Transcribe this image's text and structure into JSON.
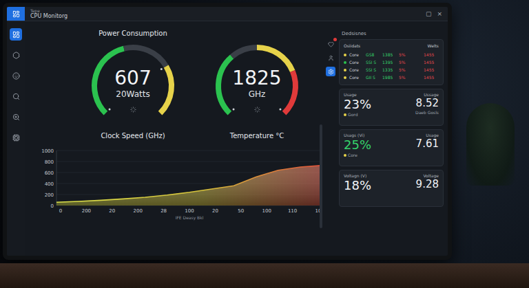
{
  "window": {
    "title": "Tepe",
    "app_title": "CPU Monitorg",
    "controls": [
      "▢",
      "×"
    ]
  },
  "sidebar": {
    "items": [
      {
        "selected": true
      },
      {
        "selected": false
      },
      {
        "selected": false
      },
      {
        "selected": false
      },
      {
        "selected": false
      },
      {
        "selected": false
      }
    ]
  },
  "gauges": [
    {
      "title": "Power Consumption",
      "value": "607",
      "unit": "20Watts",
      "caption": "Clock Speed (GHz)",
      "level": 0.72,
      "segments": [
        {
          "color": "#2bc24f",
          "level": 0.45
        },
        {
          "color": "#3a3f47",
          "level": 0.72
        },
        {
          "color": "#e6d24a",
          "level": 1
        }
      ]
    },
    {
      "title": "",
      "value": "1825",
      "unit": "GHz",
      "caption": "Temperature °C",
      "level": 1,
      "segments": [
        {
          "color": "#2bc24f",
          "level": 0.35
        },
        {
          "color": "#3a3f47",
          "level": 0.5
        },
        {
          "color": "#e6d24a",
          "level": 0.75
        },
        {
          "color": "#e03a3a",
          "level": 1
        }
      ]
    }
  ],
  "chart": {
    "y_ticks": [
      "1000",
      "800",
      "600",
      "400",
      "200",
      "0"
    ],
    "x_ticks": [
      "0",
      "200",
      "20",
      "200",
      "28",
      "100",
      "20",
      "50",
      "100",
      "110",
      "10"
    ],
    "x_label": "IFE Deasy Bkl",
    "y_min": 0,
    "y_max": 1000,
    "series": [
      {
        "values": [
          60,
          75,
          95,
          120,
          150,
          190,
          240,
          300,
          360,
          520,
          640,
          700,
          730
        ]
      }
    ]
  },
  "panel": {
    "title": "Dedsisnes",
    "tabs": [
      {
        "selected": false,
        "badge": true
      },
      {
        "selected": false,
        "badge": false
      },
      {
        "selected": true,
        "badge": false
      }
    ],
    "table": {
      "title": "Osiidats",
      "unit": "Welts",
      "rows": [
        {
          "name": "Core",
          "color": "#e6d24a",
          "values": [
            "GS8",
            "1385"
          ],
          "readings": [
            "5%",
            "1455"
          ]
        },
        {
          "name": "Core",
          "color": "#2bc24f",
          "values": [
            "SSI S",
            "1395"
          ],
          "readings": [
            "5%",
            "1455"
          ]
        },
        {
          "name": "Core",
          "color": "#e6d24a",
          "values": [
            "SSI S",
            "1335"
          ],
          "readings": [
            "5%",
            "1455"
          ]
        },
        {
          "name": "Core",
          "color": "#e6d24a",
          "values": [
            "GII S",
            "1985"
          ],
          "readings": [
            "5%",
            "1455"
          ]
        }
      ]
    },
    "cards": [
      {
        "label": "Usage",
        "value": "23%",
        "value_color": "#f2f4f7",
        "sub": "Gord",
        "right_label": "Ussage",
        "right_value": "8.52",
        "right_sub": "Daeb Gosls"
      },
      {
        "label": "Usags (Vi)",
        "value": "25%",
        "value_color": "#35d16a",
        "sub": "Core",
        "right_label": "Usage",
        "right_value": "7.61",
        "right_sub": ""
      },
      {
        "label": "Voltagn (V)",
        "value": "18%",
        "value_color": "#f2f4f7",
        "sub": "",
        "right_label": "Voltage",
        "right_value": "9.28",
        "right_sub": ""
      }
    ]
  }
}
